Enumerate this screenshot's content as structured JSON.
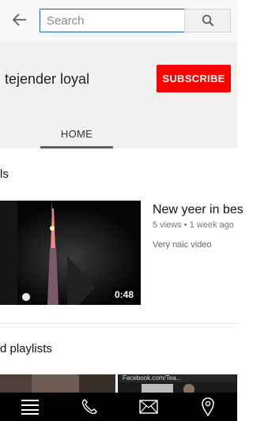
{
  "search": {
    "placeholder": "Search",
    "value": ""
  },
  "channel": {
    "name": "tejender loyal",
    "subscribe_label": "SUBSCRIBE"
  },
  "tabs": [
    {
      "label": "HOME",
      "active": true
    }
  ],
  "sections": {
    "uploads_title": "ls",
    "playlists_title": "d playlists"
  },
  "video": {
    "title": "New yeer in bes",
    "meta": "5 views • 1 week ago",
    "description": "Very naic video",
    "duration": "0:48"
  },
  "playlist_overlay_text": "Facebook.com/Tea...",
  "bottom_nav": [
    {
      "icon": "menu-icon"
    },
    {
      "icon": "phone-icon"
    },
    {
      "icon": "mail-icon"
    },
    {
      "icon": "location-pin-icon"
    }
  ],
  "colors": {
    "accent": "#ff0000",
    "search_border": "#1c62b9",
    "nav_bg": "#000000"
  }
}
